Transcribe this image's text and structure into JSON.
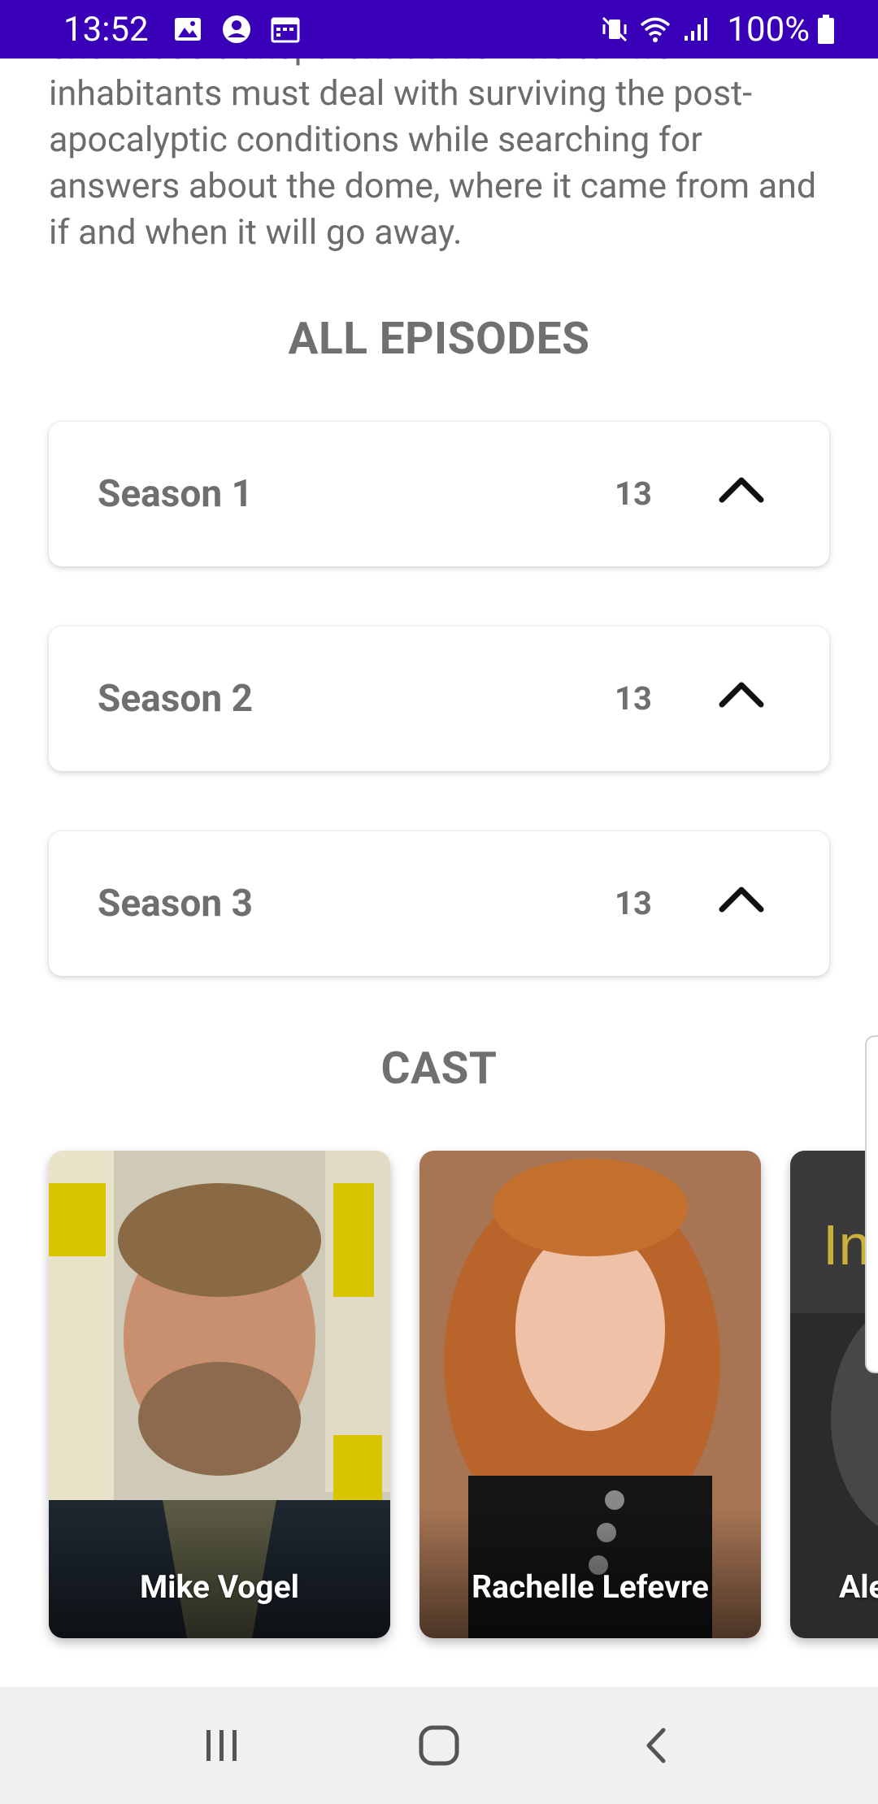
{
  "status_bar": {
    "time": "13:52",
    "battery": "100%",
    "background": "#3a00b8",
    "left_icons": [
      "gallery-icon",
      "account-circle-icon",
      "calendar-icon"
    ],
    "right_icons": [
      "vibrate-mute-icon",
      "wifi-icon",
      "signal-icon",
      "battery-icon"
    ]
  },
  "show": {
    "description": "enormous transparent dome. The town's inhabitants must deal with surviving the post-apocalyptic conditions while searching for answers about the dome, where it came from and if and when it will go away."
  },
  "episodes": {
    "heading": "ALL EPISODES",
    "seasons": [
      {
        "label": "Season 1",
        "count": "13"
      },
      {
        "label": "Season 2",
        "count": "13"
      },
      {
        "label": "Season 3",
        "count": "13"
      }
    ]
  },
  "cast": {
    "heading": "CAST",
    "members": [
      {
        "name": "Mike Vogel"
      },
      {
        "name": "Rachelle Lefevre"
      },
      {
        "name": "Ale"
      }
    ]
  },
  "nav_bar": {
    "buttons": [
      "recent-apps-icon",
      "home-icon",
      "back-icon"
    ]
  }
}
